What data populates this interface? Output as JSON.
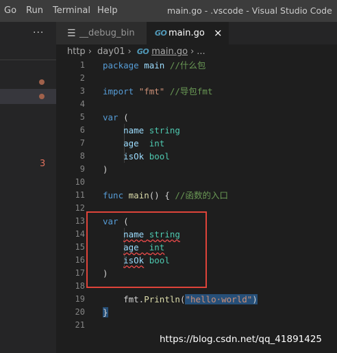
{
  "menu": {
    "go": "Go",
    "run": "Run",
    "terminal": "Terminal",
    "help": "Help"
  },
  "window_title": "main.go - .vscode - Visual Studio Code",
  "sidebar": {
    "more": "···",
    "badge_count": "3"
  },
  "tabs": [
    {
      "label": "__debug_bin"
    },
    {
      "label": "main.go",
      "close": "×"
    }
  ],
  "breadcrumb": {
    "folder1": "http",
    "sep1": "›",
    "folder2": "day01",
    "sep2": "›",
    "file": "main.go",
    "sep3": "›",
    "more": "..."
  },
  "code": {
    "ln": [
      "1",
      "2",
      "3",
      "4",
      "5",
      "6",
      "7",
      "8",
      "9",
      "10",
      "11",
      "12",
      "13",
      "14",
      "15",
      "16",
      "17",
      "18",
      "19",
      "20",
      "21"
    ],
    "l1": {
      "kw": "package",
      "name": "main",
      "comment": "//什么包"
    },
    "l3": {
      "kw": "import",
      "str": "\"fmt\"",
      "comment": "//导包fmt"
    },
    "l5": {
      "kw": "var",
      "rest": "("
    },
    "l6": {
      "name": "name",
      "type": "string"
    },
    "l7": {
      "name": "age",
      "type": "int"
    },
    "l8": {
      "name": "isOk",
      "type": "bool"
    },
    "l9": ")",
    "l11": {
      "kw": "func",
      "fn": "main",
      "rest": "() {",
      "comment": "//函数的入口"
    },
    "l13": {
      "kw": "var",
      "rest": "("
    },
    "l14": {
      "name": "name",
      "type": "string"
    },
    "l15": {
      "name": "age",
      "type": "int"
    },
    "l16": {
      "name": "isOk",
      "type": "bool"
    },
    "l17": ")",
    "l19": {
      "pkg": "fmt.",
      "fn": "Println",
      "open": "(",
      "str": "\"hello·world\"",
      "close": ")"
    },
    "l20": "}"
  },
  "watermark": "https://blog.csdn.net/qq_41891425"
}
